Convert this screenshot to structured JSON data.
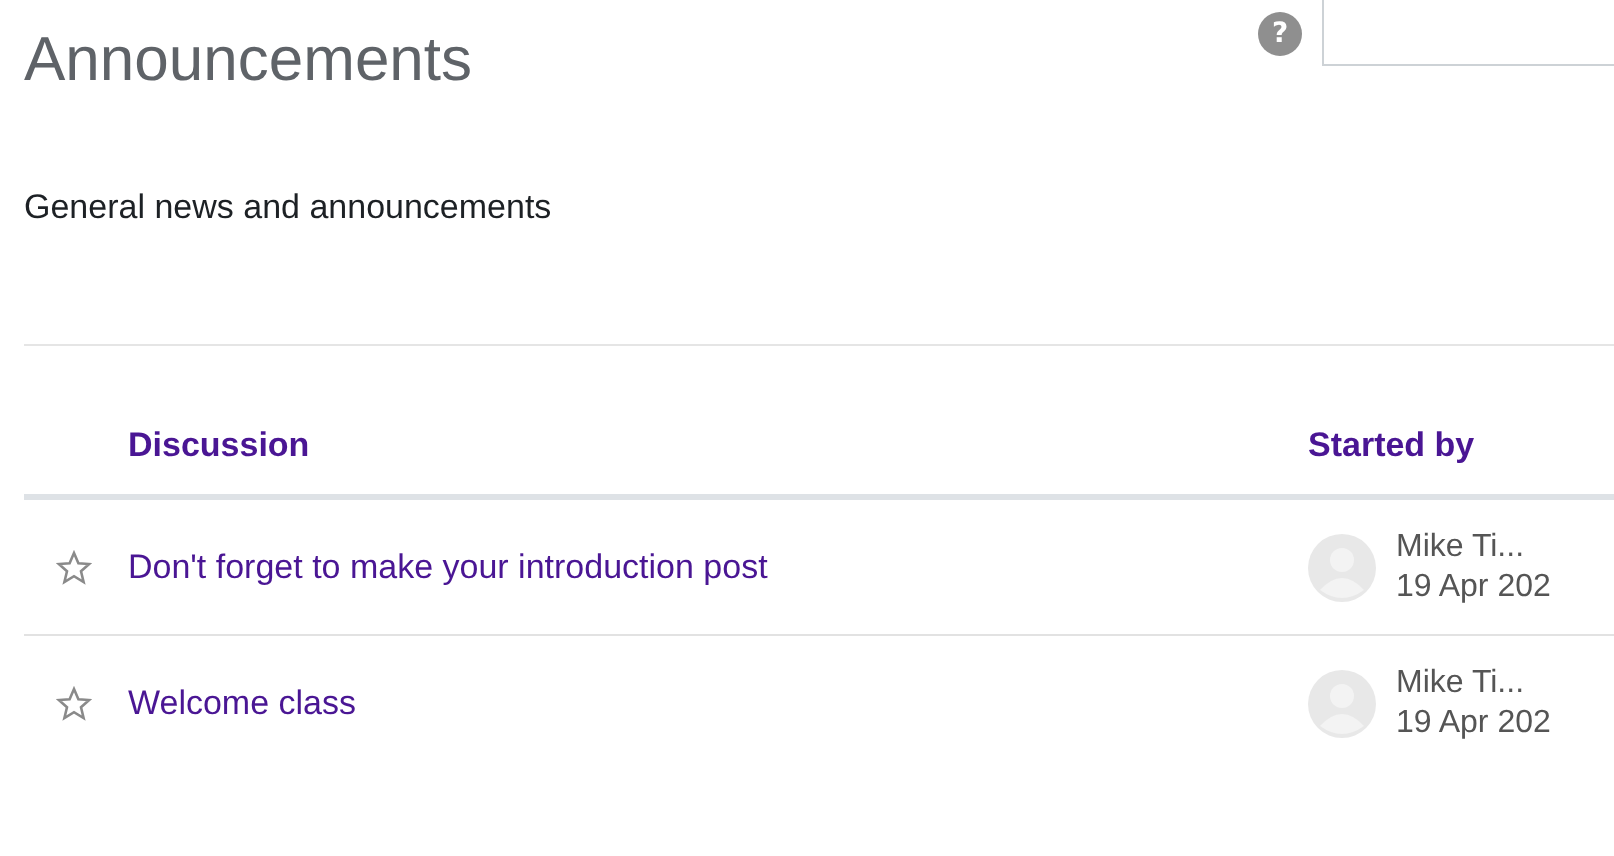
{
  "title": "Announcements",
  "help": {
    "icon_text": "?"
  },
  "description": "General news and announcements",
  "table": {
    "columns": [
      "Discussion",
      "Started by"
    ],
    "rows": [
      {
        "starred": false,
        "discussion": "Don't forget to make your introduction post",
        "author": "Mike Ti...",
        "date": "19 Apr 202"
      },
      {
        "starred": false,
        "discussion": "Welcome class",
        "author": "Mike Ti...",
        "date": "19 Apr 202"
      }
    ]
  }
}
